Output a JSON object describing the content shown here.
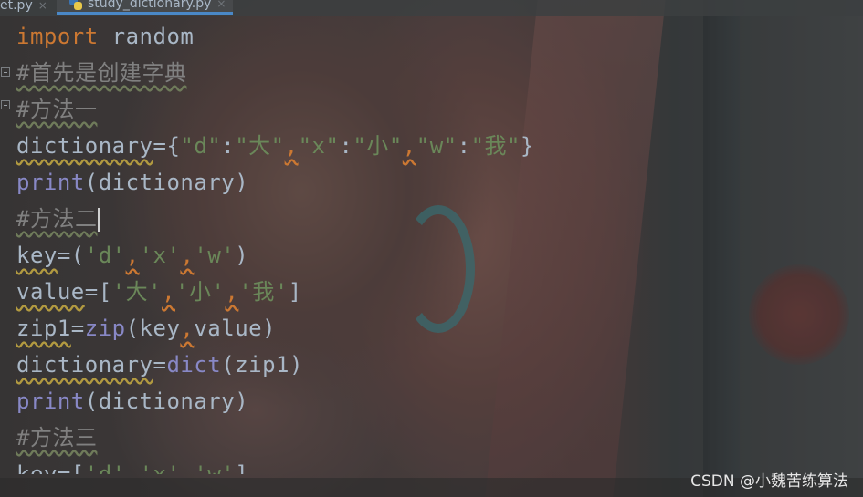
{
  "tabs": [
    {
      "label": "et.py",
      "close": "×",
      "active": false
    },
    {
      "label": "study_dictionary.py",
      "close": "×",
      "active": true
    }
  ],
  "code_lines": [
    {
      "tokens": [
        {
          "t": "import",
          "c": "kw"
        },
        {
          "t": " random",
          "c": "pun"
        }
      ]
    },
    {
      "tokens": [
        {
          "t": "#首先是创建字典",
          "c": "cm"
        }
      ]
    },
    {
      "tokens": [
        {
          "t": "#方法一",
          "c": "cm"
        }
      ]
    },
    {
      "tokens": [
        {
          "t": "dictionary",
          "c": "sq"
        },
        {
          "t": "={",
          "c": "pun"
        },
        {
          "t": "\"d\"",
          "c": "str"
        },
        {
          "t": ":",
          "c": "pun"
        },
        {
          "t": "\"大\"",
          "c": "str"
        },
        {
          "t": ",",
          "c": "warn"
        },
        {
          "t": "\"x\"",
          "c": "str"
        },
        {
          "t": ":",
          "c": "pun"
        },
        {
          "t": "\"小\"",
          "c": "str"
        },
        {
          "t": ",",
          "c": "warn"
        },
        {
          "t": "\"w\"",
          "c": "str"
        },
        {
          "t": ":",
          "c": "pun"
        },
        {
          "t": "\"我\"",
          "c": "str"
        },
        {
          "t": "}",
          "c": "pun"
        }
      ]
    },
    {
      "tokens": [
        {
          "t": "print",
          "c": "fn"
        },
        {
          "t": "(dictionary)",
          "c": "pun"
        }
      ]
    },
    {
      "tokens": [
        {
          "t": "#方法二",
          "c": "cm"
        }
      ],
      "caret": true
    },
    {
      "tokens": [
        {
          "t": "key",
          "c": "sq"
        },
        {
          "t": "=(",
          "c": "pun"
        },
        {
          "t": "'d'",
          "c": "str"
        },
        {
          "t": ",",
          "c": "warn"
        },
        {
          "t": "'x'",
          "c": "str"
        },
        {
          "t": ",",
          "c": "warn"
        },
        {
          "t": "'w'",
          "c": "str"
        },
        {
          "t": ")",
          "c": "pun"
        }
      ]
    },
    {
      "tokens": [
        {
          "t": "value",
          "c": "sq"
        },
        {
          "t": "=[",
          "c": "pun"
        },
        {
          "t": "'大'",
          "c": "str"
        },
        {
          "t": ",",
          "c": "warn"
        },
        {
          "t": "'小'",
          "c": "str"
        },
        {
          "t": ",",
          "c": "warn"
        },
        {
          "t": "'我'",
          "c": "str"
        },
        {
          "t": "]",
          "c": "pun"
        }
      ]
    },
    {
      "tokens": [
        {
          "t": "zip1",
          "c": "sq"
        },
        {
          "t": "=",
          "c": "pun"
        },
        {
          "t": "zip",
          "c": "fn"
        },
        {
          "t": "(key",
          "c": "pun"
        },
        {
          "t": ",",
          "c": "warn"
        },
        {
          "t": "value)",
          "c": "pun"
        }
      ]
    },
    {
      "tokens": [
        {
          "t": "dictionary",
          "c": "sq"
        },
        {
          "t": "=",
          "c": "pun"
        },
        {
          "t": "dict",
          "c": "fn"
        },
        {
          "t": "(zip1)",
          "c": "pun"
        }
      ]
    },
    {
      "tokens": [
        {
          "t": "print",
          "c": "fn"
        },
        {
          "t": "(dictionary)",
          "c": "pun"
        }
      ]
    },
    {
      "tokens": [
        {
          "t": "#方法三",
          "c": "cm"
        }
      ]
    },
    {
      "tokens": [
        {
          "t": "key",
          "c": "sq"
        },
        {
          "t": "=[",
          "c": "pun"
        },
        {
          "t": "'d'",
          "c": "str"
        },
        {
          "t": ",",
          "c": "warn"
        },
        {
          "t": "'x'",
          "c": "str"
        },
        {
          "t": ",",
          "c": "warn"
        },
        {
          "t": "'w'",
          "c": "str"
        },
        {
          "t": "]",
          "c": "pun"
        }
      ]
    }
  ],
  "watermark": "CSDN @小魏苦练算法",
  "colors": {
    "keyword": "#cc7832",
    "builtin": "#8888c6",
    "string": "#6a8759",
    "comment": "#808080",
    "text": "#a9b7c6",
    "active_tab_underline": "#4a88c7"
  },
  "icons": {
    "tab_file_icon": "python-file-icon",
    "fold_icon": "fold-marker-icon"
  }
}
